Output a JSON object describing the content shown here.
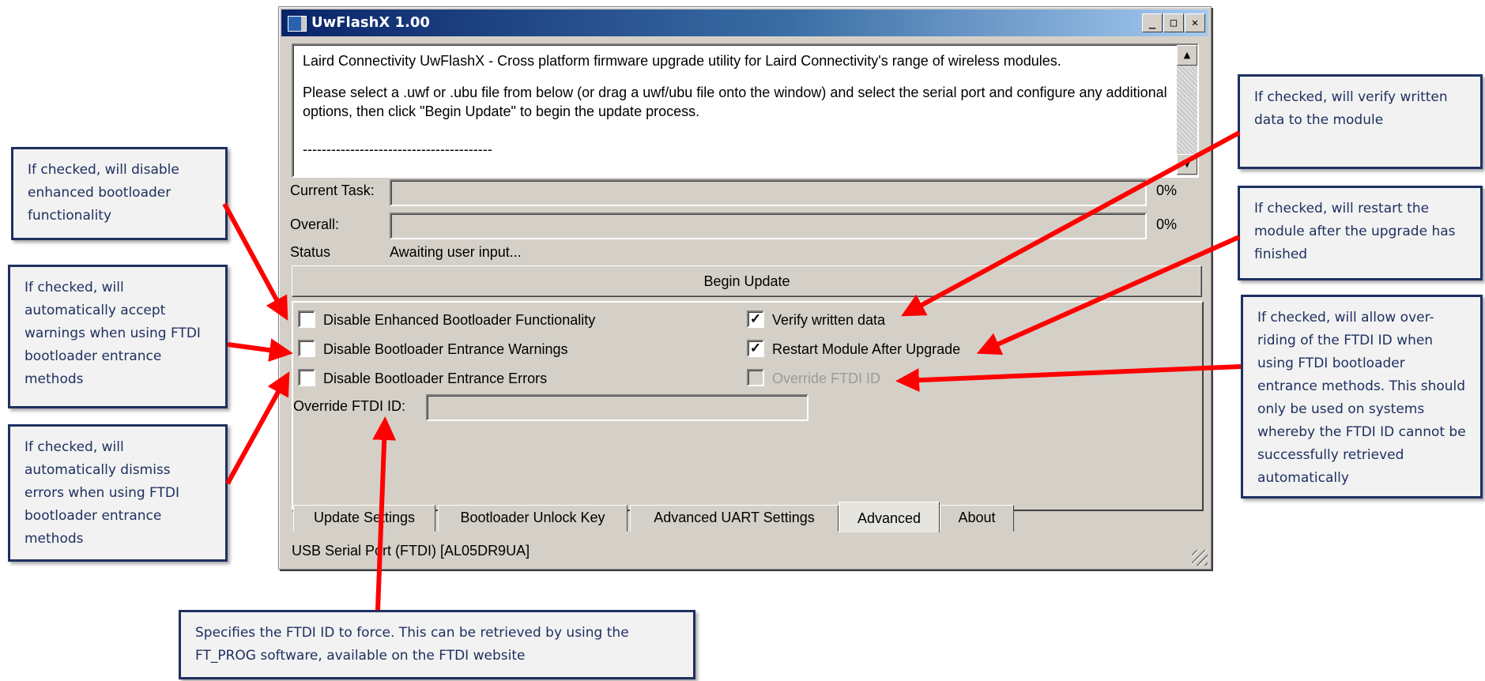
{
  "window": {
    "title": "UwFlashX 1.00",
    "minimize": "_",
    "maximize": "□",
    "close": "✕"
  },
  "log": {
    "line1": "Laird Connectivity UwFlashX - Cross platform firmware upgrade utility for Laird Connectivity's range of wireless modules.",
    "line2": "Please select a .uwf or .ubu file from below (or drag a uwf/ubu file onto the window) and select the serial port and configure any additional options, then click \"Begin Update\" to begin the update process.",
    "line3": "----------------------------------------"
  },
  "progress": {
    "current_task_label": "Current Task:",
    "current_task_value": "0%",
    "overall_label": "Overall:",
    "overall_value": "0%",
    "status_label": "Status",
    "status_value": "Awaiting user input..."
  },
  "begin_button": "Begin Update",
  "options": {
    "disable_enhanced": {
      "label": "Disable Enhanced Bootloader Functionality",
      "checked": false
    },
    "disable_warnings": {
      "label": "Disable Bootloader Entrance Warnings",
      "checked": false
    },
    "disable_errors": {
      "label": "Disable Bootloader Entrance Errors",
      "checked": false
    },
    "verify": {
      "label": "Verify written data",
      "checked": true
    },
    "restart": {
      "label": "Restart Module After Upgrade",
      "checked": true
    },
    "override_ftdi": {
      "label": "Override FTDI ID",
      "checked": false,
      "enabled": false
    },
    "ftdi_id_label": "Override FTDI ID:",
    "ftdi_id_value": ""
  },
  "tabs": [
    {
      "label": "Update Settings"
    },
    {
      "label": "Bootloader Unlock Key"
    },
    {
      "label": "Advanced UART Settings"
    },
    {
      "label": "Advanced"
    },
    {
      "label": "About"
    }
  ],
  "active_tab": "Advanced",
  "status_bar": "USB Serial Port (FTDI) [AL05DR9UA]",
  "callouts": {
    "enhanced": "If checked, will disable enhanced bootloader functionality",
    "warnings": "If checked, will automatically accept warnings when using FTDI bootloader entrance methods",
    "errors": "If checked, will automatically dismiss errors when using FTDI bootloader entrance methods",
    "verify": "If checked, will verify written data to the module",
    "restart": "If checked, will restart the module after the upgrade has finished",
    "override": "If checked, will allow over-riding of the FTDI ID when using FTDI bootloader entrance methods. This should only be used on systems whereby the FTDI ID cannot be successfully retrieved automatically",
    "ftdi_id": "Specifies the FTDI ID to force. This can be retrieved by using the FT_PROG software, available on the FTDI website"
  },
  "colors": {
    "callout_border": "#1f3060",
    "arrow": "#ff0000",
    "title_gradient_start": "#0a246a"
  }
}
